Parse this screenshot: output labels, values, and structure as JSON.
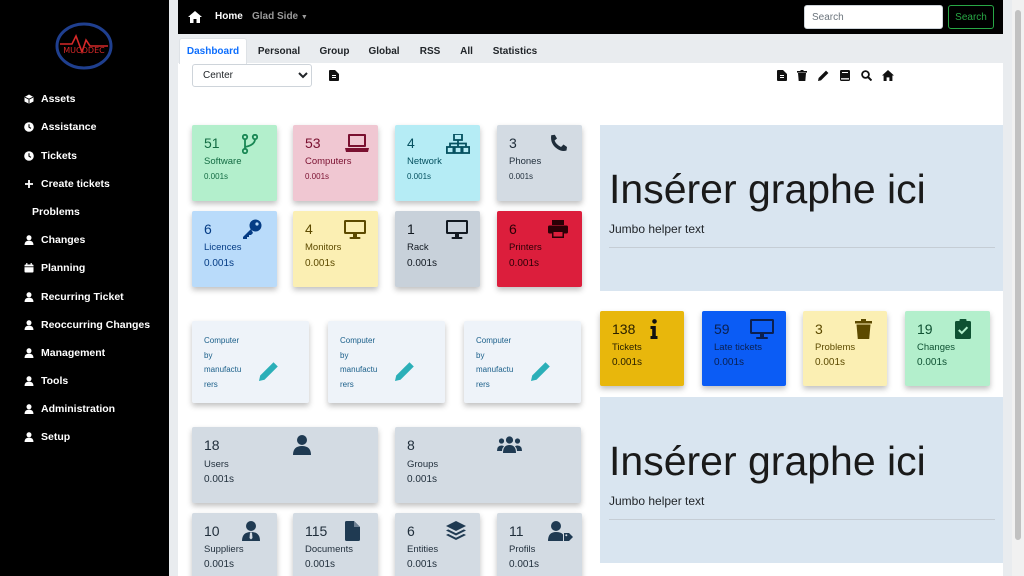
{
  "sidebar": {
    "logo_text": "MUCODEC",
    "items": [
      {
        "label": "Assets",
        "icon": "cube-icon"
      },
      {
        "label": "Assistance",
        "icon": "clock-icon"
      },
      {
        "label": "Tickets",
        "icon": "clock-icon"
      },
      {
        "label": "Create tickets",
        "icon": "plus-icon"
      },
      {
        "label": "Problems",
        "icon": ""
      },
      {
        "label": "Changes",
        "icon": "user-icon"
      },
      {
        "label": "Planning",
        "icon": "calendar-icon"
      },
      {
        "label": "Recurring Ticket",
        "icon": "user-icon"
      },
      {
        "label": "Reoccurring Changes",
        "icon": "user-icon"
      },
      {
        "label": "Management",
        "icon": "user-icon"
      },
      {
        "label": "Tools",
        "icon": "user-icon"
      },
      {
        "label": "Administration",
        "icon": "user-icon"
      },
      {
        "label": "Setup",
        "icon": "user-icon"
      }
    ]
  },
  "topbar": {
    "home_label": "Home",
    "entity_label": "Glad Side",
    "search_placeholder": "Search",
    "search_button": "Search"
  },
  "tabs": [
    "Dashboard",
    "Personal",
    "Group",
    "Global",
    "RSS",
    "All",
    "Statistics"
  ],
  "active_tab": "Dashboard",
  "filter": {
    "selected": "Center"
  },
  "colors": {
    "green": "#28a745",
    "sidebar": "#000000",
    "jumbo": "#d9e5f0"
  },
  "asset_cards": [
    {
      "num": "51",
      "label": "Software",
      "time": "0.001s",
      "icon": "code-branch-icon"
    },
    {
      "num": "53",
      "label": "Computers",
      "time": "0.001s",
      "icon": "laptop-icon"
    },
    {
      "num": "4",
      "label": "Network",
      "time": "0.001s",
      "icon": "network-icon"
    },
    {
      "num": "3",
      "label": "Phones",
      "time": "0.001s",
      "icon": "phone-icon"
    },
    {
      "num": "6",
      "label": "Licences",
      "time": "0.001s",
      "icon": "key-icon"
    },
    {
      "num": "4",
      "label": "Monitors",
      "time": "0.001s",
      "icon": "monitor-icon"
    },
    {
      "num": "1",
      "label": "Rack",
      "time": "0.001s",
      "icon": "desktop-icon"
    },
    {
      "num": "6",
      "label": "Printers",
      "time": "0.001s",
      "icon": "printer-icon"
    }
  ],
  "jumbos": [
    {
      "title": "Insérer graphe ici",
      "helper": "Jumbo helper text"
    },
    {
      "title": "Insérer graphe ici",
      "helper": "Jumbo helper text"
    }
  ],
  "ticket_cards": [
    {
      "num": "138",
      "label": "Tickets",
      "time": "0.001s",
      "icon": "info-icon"
    },
    {
      "num": "59",
      "label": "Late tickets",
      "time": "0.001s",
      "icon": "desktop-icon"
    },
    {
      "num": "3",
      "label": "Problems",
      "time": "0.001s",
      "icon": "trash-icon"
    },
    {
      "num": "19",
      "label": "Changes",
      "time": "0.001s",
      "icon": "clipboard-check-icon"
    }
  ],
  "link_cards": [
    {
      "text": "Computer by manufacturers",
      "lines": [
        "Computer",
        "by",
        "manufactu",
        "rers"
      ]
    },
    {
      "text": "Computer by manufacturers",
      "lines": [
        "Computer",
        "by",
        "manufactu",
        "rers"
      ]
    },
    {
      "text": "Computer by manufacturers",
      "lines": [
        "Computer",
        "by",
        "manufactu",
        "rers"
      ]
    }
  ],
  "people_cards": [
    {
      "num": "18",
      "label": "Users",
      "time": "0.001s",
      "icon": "user-icon"
    },
    {
      "num": "8",
      "label": "Groups",
      "time": "0.001s",
      "icon": "users-icon"
    },
    {
      "num": "10",
      "label": "Suppliers",
      "time": "0.001s",
      "icon": "user-tie-icon"
    },
    {
      "num": "115",
      "label": "Documents",
      "time": "0.001s",
      "icon": "file-icon"
    },
    {
      "num": "6",
      "label": "Entities",
      "time": "0.001s",
      "icon": "layers-icon"
    },
    {
      "num": "11",
      "label": "Profils",
      "time": "0.001s",
      "icon": "user-tag-icon"
    }
  ]
}
